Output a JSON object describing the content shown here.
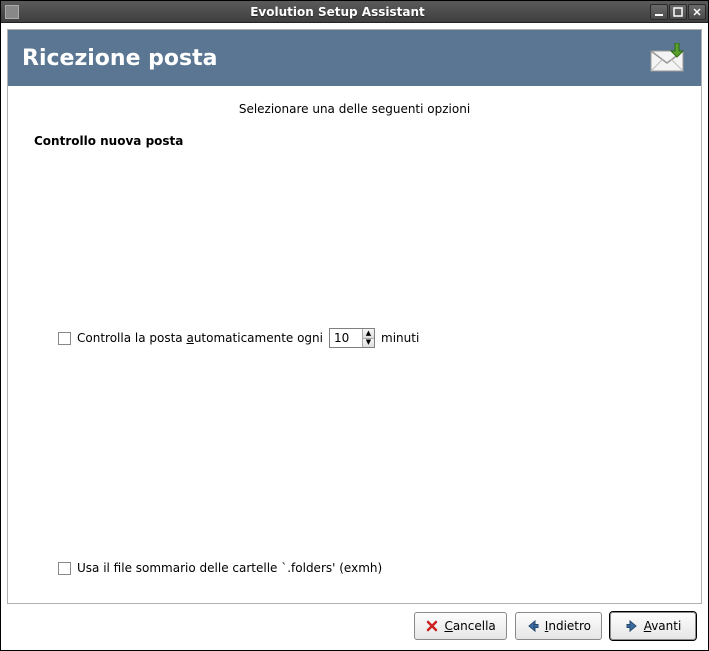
{
  "window": {
    "title": "Evolution Setup Assistant"
  },
  "header": {
    "title": "Ricezione posta"
  },
  "content": {
    "instruction": "Selezionare una delle seguenti opzioni",
    "section_heading": "Controllo nuova posta",
    "auto_check": {
      "prefix": "Controlla la posta ",
      "mn": "a",
      "rest": "utomaticamente ogni",
      "value": "10",
      "suffix": "minuti"
    },
    "use_folders_summary": "Usa il file sommario delle cartelle `.folders' (exmh)"
  },
  "buttons": {
    "cancel": {
      "mn": "C",
      "rest": "ancella"
    },
    "back": {
      "mn": "I",
      "rest": "ndietro"
    },
    "next": {
      "mn": "A",
      "rest": "vanti"
    }
  }
}
